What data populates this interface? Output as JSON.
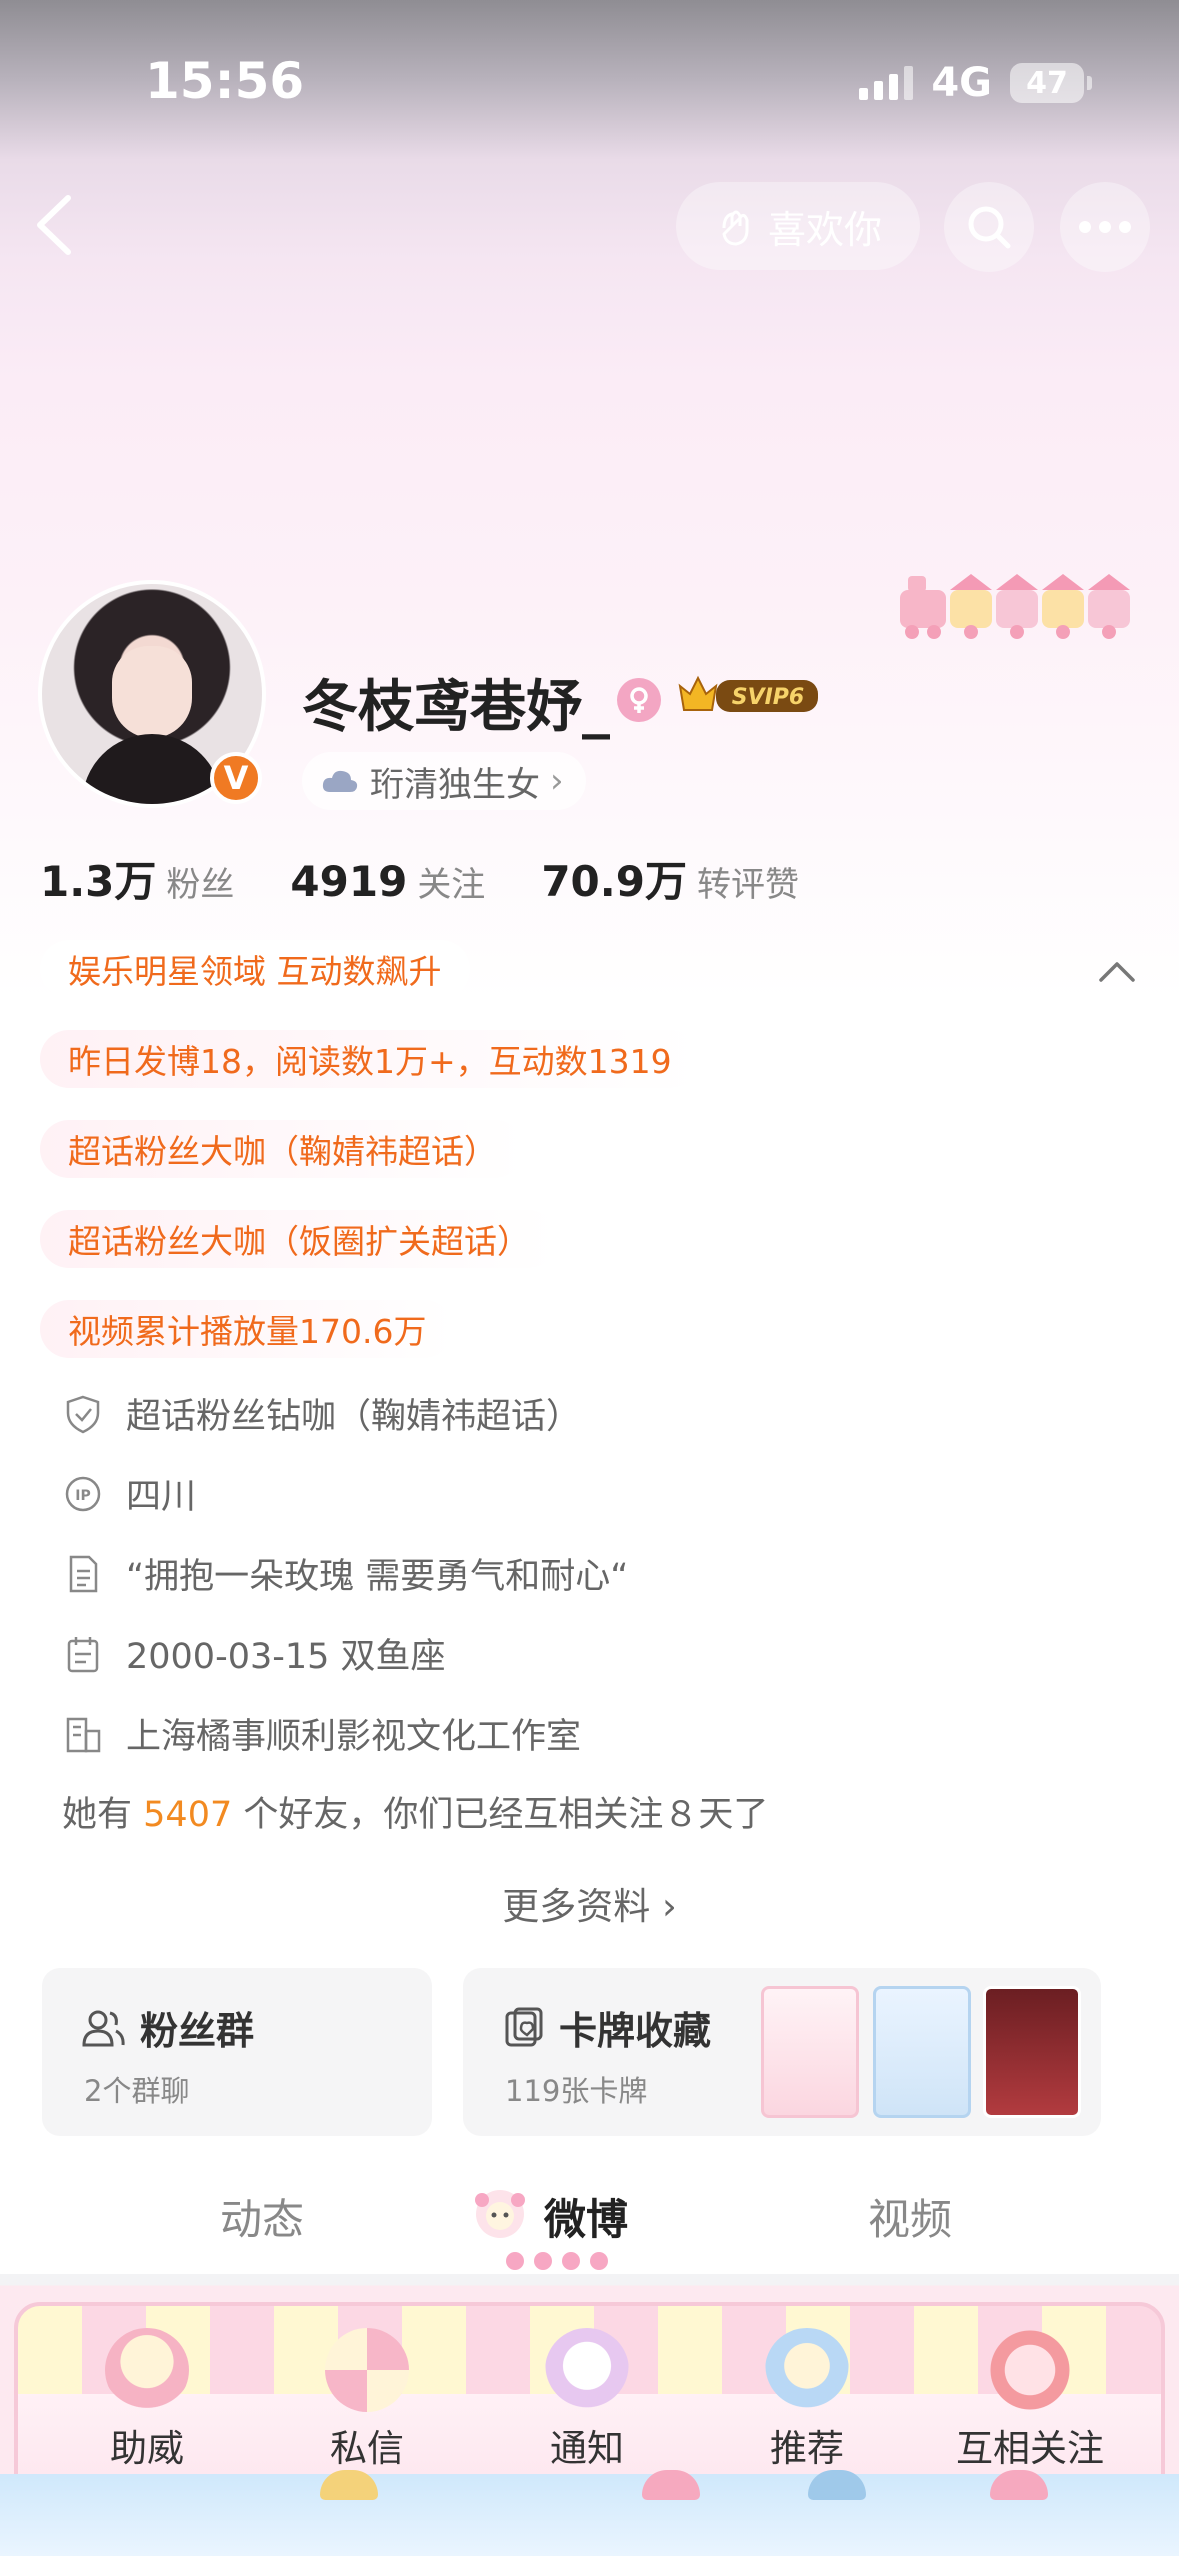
{
  "status_bar": {
    "time": "15:56",
    "network": "4G",
    "battery": "47"
  },
  "header": {
    "like_label": "喜欢你"
  },
  "profile": {
    "name": "冬枝鸢巷妤_",
    "vip_badge": "SVIP6",
    "verified_badge": "V",
    "tag": "珩清独生女",
    "stats": [
      {
        "value": "1.3万",
        "label": "粉丝"
      },
      {
        "value": "4919",
        "label": "关注"
      },
      {
        "value": "70.9万",
        "label": "转评赞"
      }
    ]
  },
  "achievements": [
    "娱乐明星领域 互动数飙升",
    "昨日发博18，阅读数1万+，互动数1319",
    "超话粉丝大咖（鞠婧祎超话）",
    "超话粉丝大咖（饭圈扩关超话）",
    "视频累计播放量170.6万"
  ],
  "info": {
    "super_topic": "超话粉丝钻咖（鞠婧祎超话）",
    "ip_location": "四川",
    "bio": "“拥抱一朵玫瑰 需要勇气和耐心“",
    "birthday": "2000-03-15 双鱼座",
    "company": "上海橘事顺利影视文化工作室"
  },
  "friends": {
    "prefix": "她有",
    "count": "5407",
    "suffix": "个好友，你们已经互相关注８天了"
  },
  "more_info": "更多资料 ›",
  "cards": {
    "fan_group": {
      "title": "粉丝群",
      "subtitle": "2个群聊"
    },
    "card_collection": {
      "title": "卡牌收藏",
      "subtitle": "119张卡牌"
    }
  },
  "tabs": [
    {
      "label": "动态"
    },
    {
      "label": "微博"
    },
    {
      "label": "视频"
    }
  ],
  "bottom_nav": [
    {
      "label": "助威"
    },
    {
      "label": "私信"
    },
    {
      "label": "通知"
    },
    {
      "label": "推荐"
    },
    {
      "label": "互相关注"
    }
  ],
  "colors": {
    "accent_orange": "#f06a1c",
    "friends_count": "#f28a21",
    "verified": "#f07a23",
    "pink_theme": "#f7a7c3"
  }
}
